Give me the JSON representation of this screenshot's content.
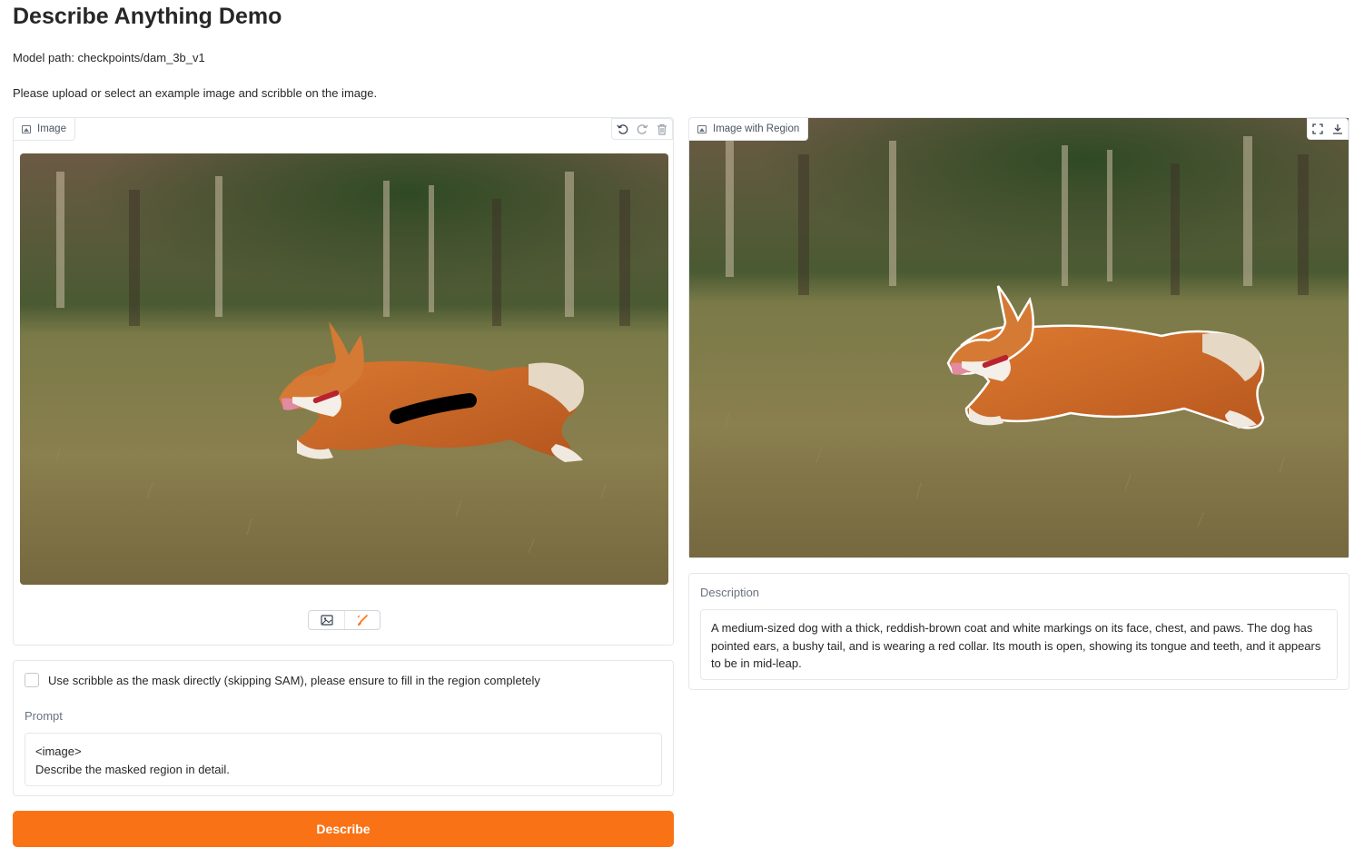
{
  "header": {
    "title": "Describe Anything Demo",
    "model_path": "Model path: checkpoints/dam_3b_v1",
    "instructions": "Please upload or select an example image and scribble on the image."
  },
  "input_panel": {
    "label": "Image",
    "icons": [
      "undo-icon",
      "redo-icon",
      "trash-icon",
      "image-icon",
      "brush-icon"
    ]
  },
  "output_panel": {
    "label": "Image with Region",
    "icons": [
      "fullscreen-icon",
      "download-icon"
    ]
  },
  "options": {
    "checkbox_label": "Use scribble as the mask directly (skipping SAM), please ensure to fill in the region completely",
    "checkbox_checked": false
  },
  "prompt": {
    "label": "Prompt",
    "value": "<image>\nDescribe the masked region in detail."
  },
  "description": {
    "label": "Description",
    "value": "A medium-sized dog with a thick, reddish-brown coat and white markings on its face, chest, and paws. The dog has pointed ears, a bushy tail, and is wearing a red collar. Its mouth is open, showing its tongue and teeth, and it appears to be in mid-leap."
  },
  "actions": {
    "describe_label": "Describe"
  },
  "colors": {
    "accent": "#f97316",
    "border": "#e5e7eb"
  }
}
